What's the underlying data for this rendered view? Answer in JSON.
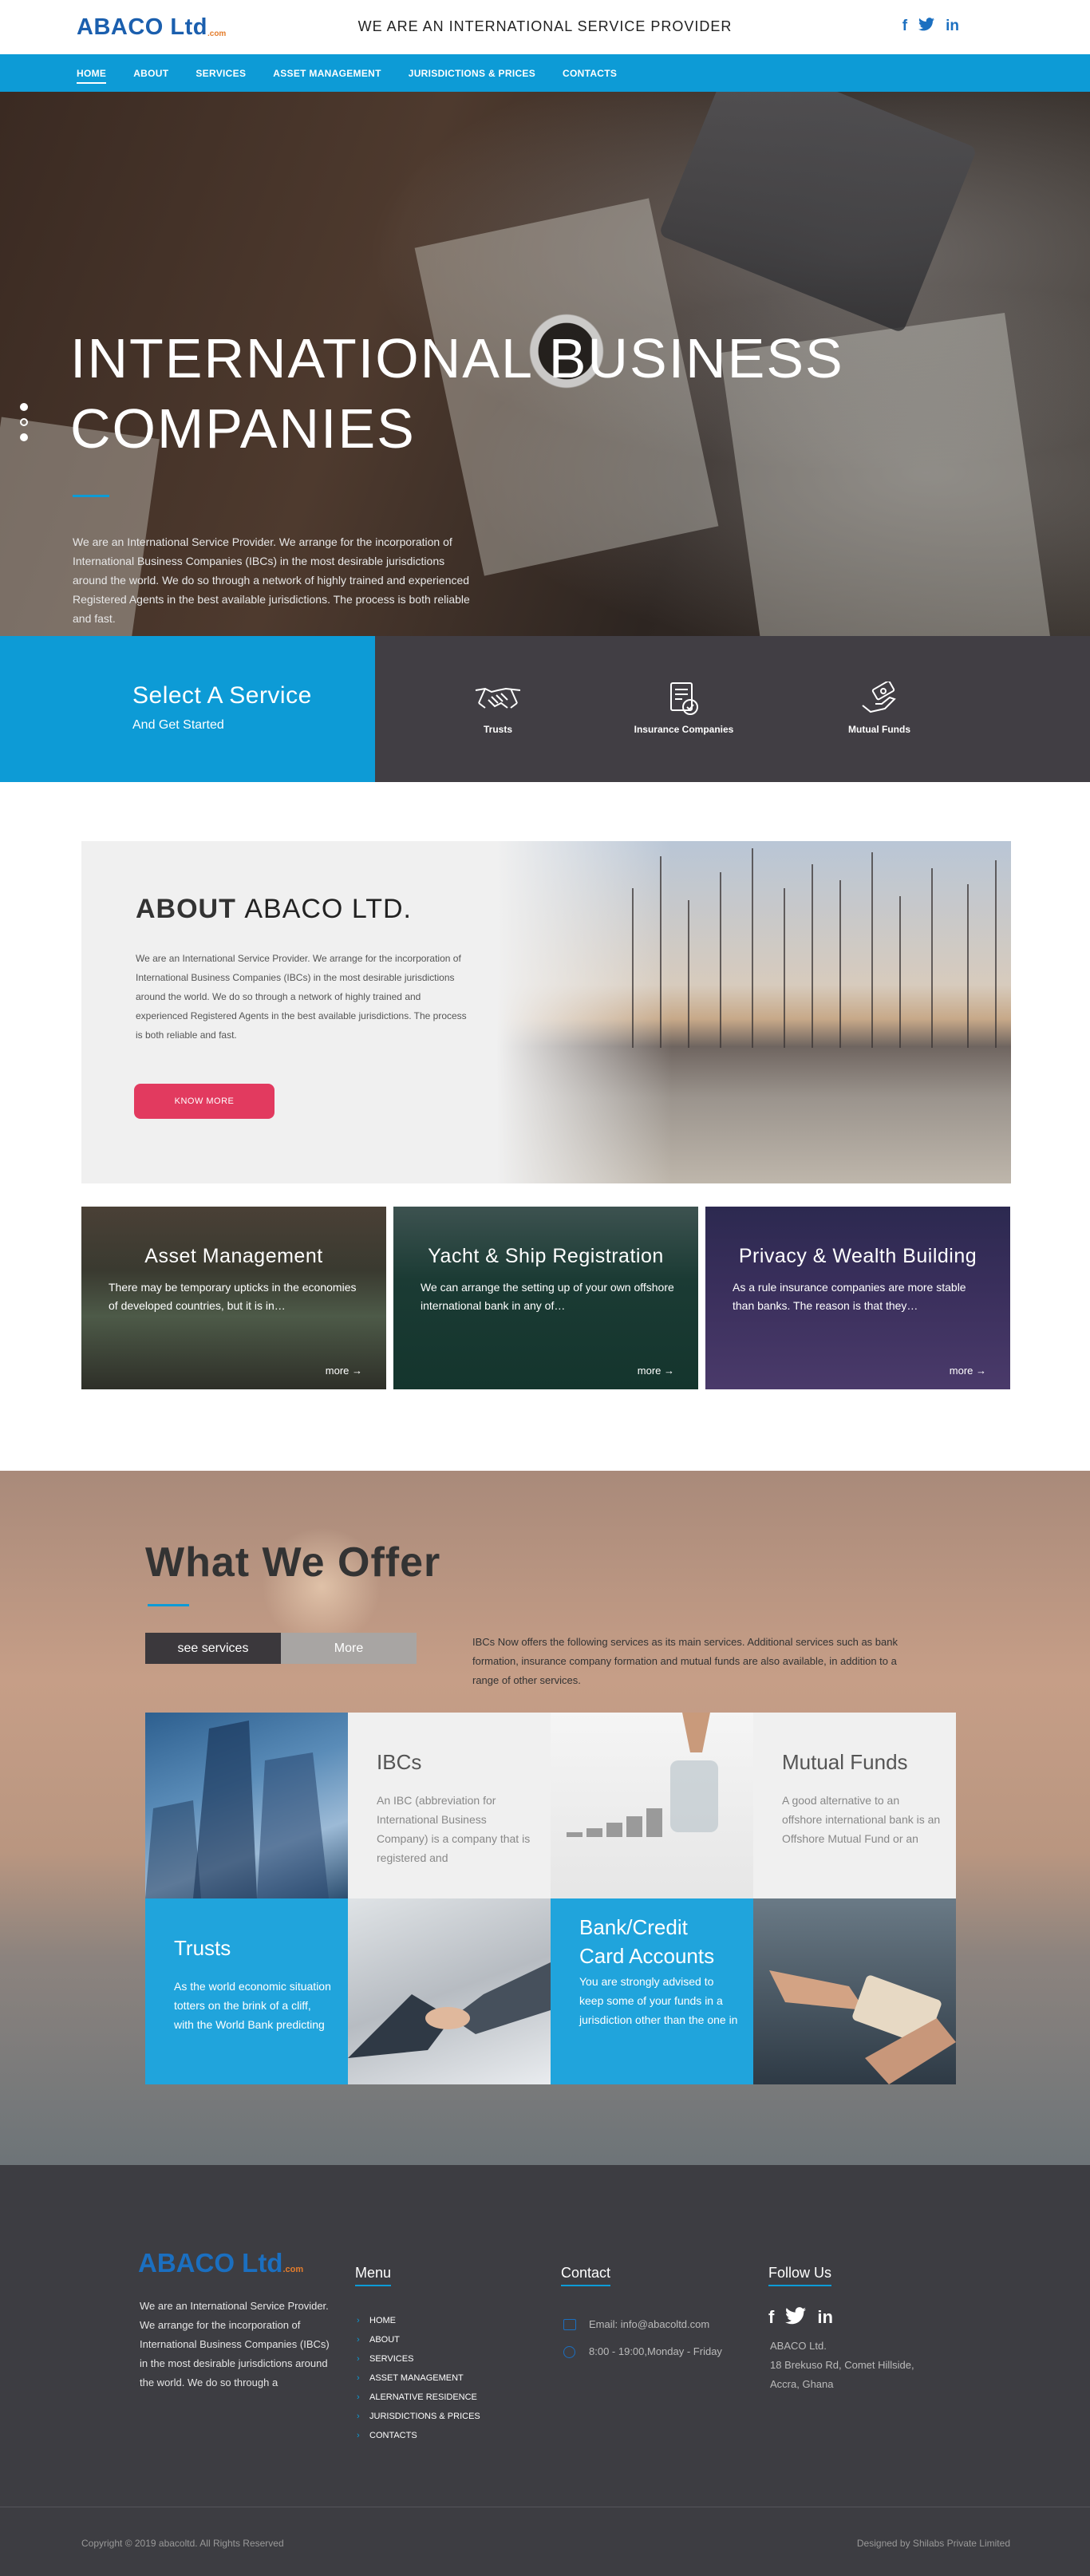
{
  "header": {
    "logo_text": "ABACO Ltd",
    "logo_suffix": ".com",
    "tagline": "WE ARE AN INTERNATIONAL SERVICE PROVIDER",
    "social": [
      "f",
      "twitter",
      "in"
    ]
  },
  "nav": {
    "items": [
      "HOME",
      "ABOUT",
      "SERVICES",
      "ASSET MANAGEMENT",
      "JURISDICTIONS & PRICES",
      "CONTACTS"
    ],
    "active": "HOME"
  },
  "hero": {
    "title": "INTERNATIONAL BUSINESS COMPANIES",
    "text": "We are an International Service Provider. We arrange for the incorporation of International Business Companies (IBCs) in the most desirable jurisdictions around the world. We do so through a network of highly trained and experienced Registered Agents in the best available jurisdictions. The process is both reliable and fast."
  },
  "select_service": {
    "title": "Select A Service",
    "subtitle": "And Get Started",
    "services": [
      {
        "label": "Trusts",
        "icon": "handshake-icon"
      },
      {
        "label": "Insurance Companies",
        "icon": "insurance-document-icon"
      },
      {
        "label": "Mutual Funds",
        "icon": "hand-money-icon"
      }
    ]
  },
  "about": {
    "title_prefix": "ABOUT",
    "title_name": "ABACO LTD.",
    "text": "We are an International Service Provider. We arrange for the incorporation of International Business Companies (IBCs) in the most desirable jurisdictions around the world. We do so through a network of highly trained and experienced Registered Agents in the best available jurisdictions. The process is both reliable and fast.",
    "button": "KNOW MORE"
  },
  "cards": [
    {
      "title": "Asset Management",
      "text": "There may be temporary upticks in the economies of developed countries, but it is in…",
      "more": "more →"
    },
    {
      "title": "Yacht & Ship Registration",
      "text": "We can arrange the setting up of your own offshore international bank in any of…",
      "more": "more →"
    },
    {
      "title": "Privacy & Wealth Building",
      "text": "As a rule insurance companies are more stable than banks. The reason is that they…",
      "more": "more →"
    }
  ],
  "offer": {
    "title": "What We Offer",
    "tab_primary": "see services",
    "tab_secondary": "More",
    "text": "IBCs Now offers the following services as its main services. Additional services such as bank formation, insurance company formation and mutual funds are also available, in addition to a range of other services.",
    "tiles": {
      "ibcs": {
        "title": "IBCs",
        "text": "An IBC (abbreviation for International Business Company) is a company that is registered and"
      },
      "mutual": {
        "title": "Mutual Funds",
        "text": "A good alternative to an offshore international bank is an Offshore Mutual Fund or an"
      },
      "trusts": {
        "title": "Trusts",
        "text": "As the world economic situation totters on the brink of a cliff, with the World Bank predicting"
      },
      "bank": {
        "title": "Bank/Credit Card Accounts",
        "text": "You are strongly advised to keep some of your funds in a jurisdiction other than the one in"
      }
    }
  },
  "footer": {
    "logo_text": "ABACO Ltd",
    "logo_suffix": ".com",
    "about_text": "We are an International Service Provider. We arrange for the incorporation of International Business Companies (IBCs) in the most desirable jurisdictions around the world. We do so through a",
    "menu_heading": "Menu",
    "menu": [
      "HOME",
      "ABOUT",
      "SERVICES",
      "ASSET MANAGEMENT",
      "ALERNATIVE RESIDENCE",
      "JURISDICTIONS & PRICES",
      "CONTACTS"
    ],
    "contact_heading": "Contact",
    "email": "Email: info@abacoltd.com",
    "hours": "8:00 - 19:00,Monday - Friday",
    "follow_heading": "Follow Us",
    "address_lines": [
      "ABACO Ltd.",
      "18 Brekuso Rd, Comet Hillside,",
      "Accra, Ghana"
    ],
    "copyright": "Copyright © 2019  abacoltd. All Rights Reserved",
    "designed_by": "Designed by Shilabs Private Limited"
  },
  "colors": {
    "accent": "#0d9bd6",
    "brand": "#1b5fae",
    "button": "#e23a5f",
    "footer_bg": "#3d3d42"
  }
}
